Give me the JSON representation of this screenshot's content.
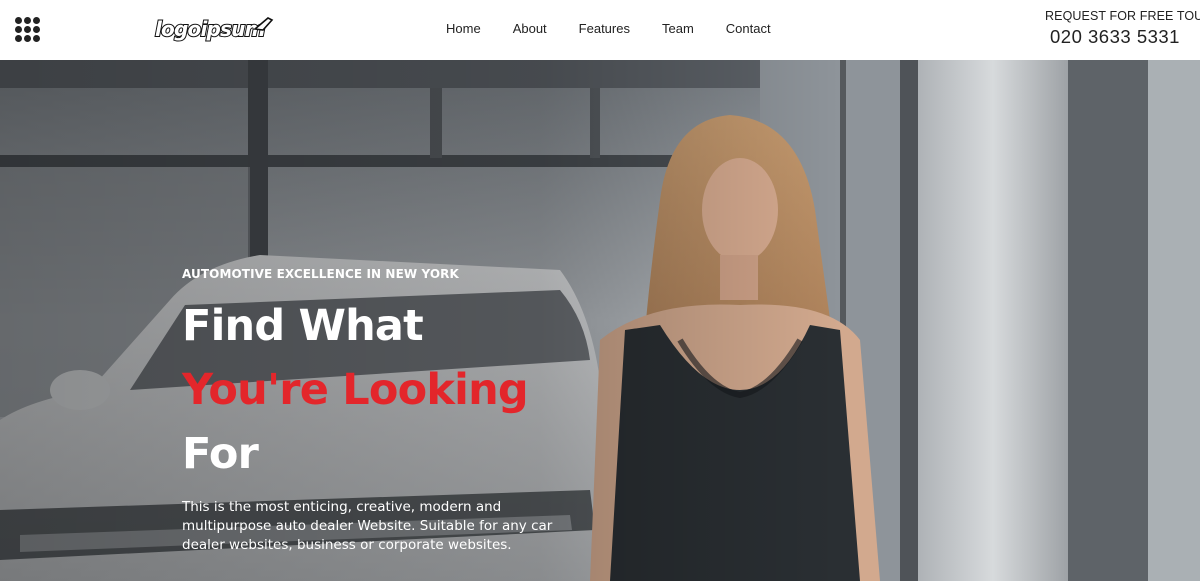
{
  "header": {
    "menu_icon": "grid-dots-icon",
    "logo_text": "logoipsum",
    "nav": [
      {
        "label": "Home"
      },
      {
        "label": "About"
      },
      {
        "label": "Features"
      },
      {
        "label": "Team"
      },
      {
        "label": "Contact"
      }
    ],
    "tour_label": "REQUEST FOR FREE TOUR",
    "phone": "020 3633 5331"
  },
  "hero": {
    "eyebrow": "AUTOMOTIVE EXCELLENCE IN NEW YORK",
    "headline_line1": "Find What",
    "headline_line2": "You're Looking",
    "headline_line3": "For",
    "description": "This is the most enticing, creative, modern and multipurpose auto dealer Website. Suitable for any car dealer websites, business or corporate websites.",
    "accent_color": "#e3262b"
  }
}
